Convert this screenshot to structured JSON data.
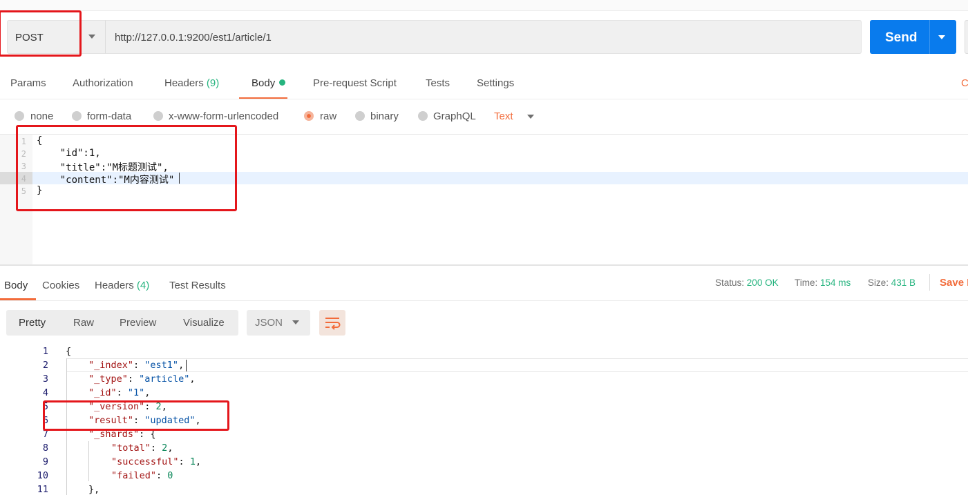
{
  "request": {
    "method": "POST",
    "url": "http://127.0.0.1:9200/est1/article/1",
    "send_label": "Send",
    "tabs": [
      {
        "label": "Params"
      },
      {
        "label": "Authorization"
      },
      {
        "label": "Headers",
        "count": "(9)"
      },
      {
        "label": "Body",
        "active": true
      },
      {
        "label": "Pre-request Script"
      },
      {
        "label": "Tests"
      },
      {
        "label": "Settings"
      }
    ],
    "cookies_edge": "C",
    "body_types": [
      "none",
      "form-data",
      "x-www-form-urlencoded",
      "raw",
      "binary",
      "GraphQL"
    ],
    "selected_body_type": "raw",
    "raw_format": "Text",
    "line_numbers": [
      "1",
      "2",
      "3",
      "4",
      "5"
    ],
    "body_lines": [
      "{",
      "    \"id\":1,",
      "    \"title\":\"M标题测试\",",
      "    \"content\":\"M内容测试\"",
      "}"
    ]
  },
  "response": {
    "tabs": [
      {
        "label": "Body",
        "active": true
      },
      {
        "label": "Cookies"
      },
      {
        "label": "Headers",
        "count": "(4)"
      },
      {
        "label": "Test Results"
      }
    ],
    "status_label": "Status:",
    "status_value": "200 OK",
    "time_label": "Time:",
    "time_value": "154 ms",
    "size_label": "Size:",
    "size_value": "431 B",
    "save_label": "Save R",
    "view_modes": [
      "Pretty",
      "Raw",
      "Preview",
      "Visualize"
    ],
    "active_view": "Pretty",
    "format": "JSON",
    "line_numbers": [
      "1",
      "2",
      "3",
      "4",
      "5",
      "6",
      "7",
      "8",
      "9",
      "10",
      "11"
    ],
    "json": {
      "open": "{",
      "index_key": "\"_index\"",
      "index_val": "\"est1\"",
      "type_key": "\"_type\"",
      "type_val": "\"article\"",
      "id_key": "\"_id\"",
      "id_val": "\"1\"",
      "version_key": "\"_version\"",
      "version_val": "2",
      "result_key": "\"result\"",
      "result_val": "\"updated\"",
      "shards_key": "\"_shards\"",
      "total_key": "\"total\"",
      "total_val": "2",
      "successful_key": "\"successful\"",
      "successful_val": "1",
      "failed_key": "\"failed\"",
      "failed_val": "0",
      "close_shards": "},"
    }
  },
  "colors": {
    "accent": "#f26b3a",
    "send": "#097bed",
    "success": "#26b47f",
    "annotation": "#e4161b"
  }
}
